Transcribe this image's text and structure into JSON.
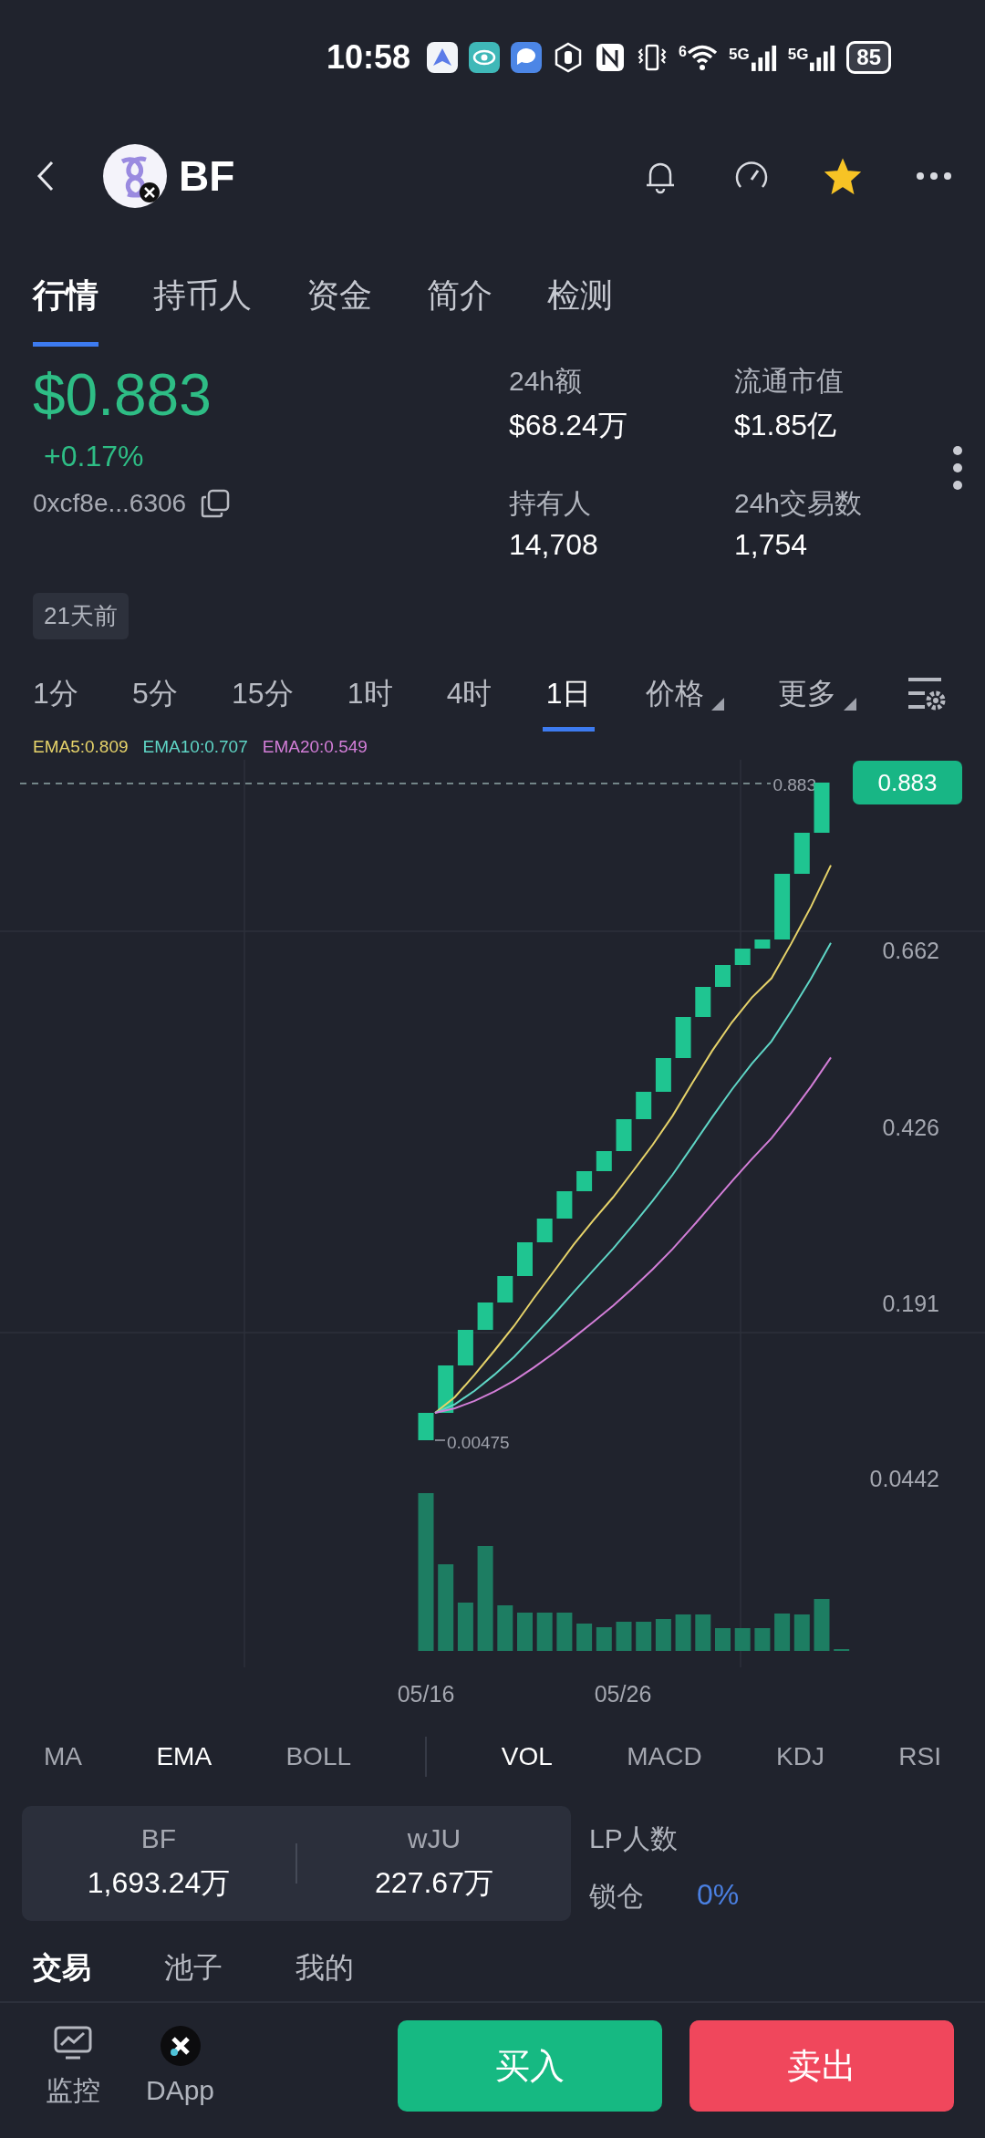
{
  "status_bar": {
    "time": "10:58",
    "wifi_label": "6",
    "network_labels": [
      "5G",
      "5G"
    ],
    "battery": "85"
  },
  "header": {
    "symbol": "BF",
    "favorite": true
  },
  "tabs": [
    {
      "label": "行情",
      "selected": true
    },
    {
      "label": "持币人",
      "selected": false
    },
    {
      "label": "资金",
      "selected": false
    },
    {
      "label": "简介",
      "selected": false
    },
    {
      "label": "检测",
      "selected": false
    }
  ],
  "price": {
    "value": "$0.883",
    "change": "+0.17%",
    "address": "0xcf8e...6306"
  },
  "stats": [
    {
      "label": "24h额",
      "value": "$68.24万"
    },
    {
      "label": "流通市值",
      "value": "$1.85亿"
    },
    {
      "label": "持有人",
      "value": "14,708"
    },
    {
      "label": "24h交易数",
      "value": "1,754"
    }
  ],
  "age_badge": "21天前",
  "intervals": [
    {
      "label": "1分",
      "kind": "interval",
      "selected": false
    },
    {
      "label": "5分",
      "kind": "interval",
      "selected": false
    },
    {
      "label": "15分",
      "kind": "interval",
      "selected": false
    },
    {
      "label": "1时",
      "kind": "interval",
      "selected": false
    },
    {
      "label": "4时",
      "kind": "interval",
      "selected": false
    },
    {
      "label": "1日",
      "kind": "interval",
      "selected": true
    },
    {
      "label": "价格",
      "kind": "dropdown",
      "selected": false
    },
    {
      "label": "更多",
      "kind": "dropdown",
      "selected": false
    }
  ],
  "ema_legend": [
    {
      "label": "EMA5:0.809",
      "color": "#e6d36a"
    },
    {
      "label": "EMA10:0.707",
      "color": "#5fd6c6"
    },
    {
      "label": "EMA20:0.549",
      "color": "#d37ed8"
    }
  ],
  "chart": {
    "price_tag": "0.883",
    "high_label": "0.883",
    "low_label": "0.00475",
    "y_labels": [
      "0.662",
      "0.426",
      "0.191",
      "0.0442"
    ],
    "x_labels": [
      "05/16",
      "05/26"
    ]
  },
  "main_indicators": [
    {
      "label": "MA",
      "selected": false
    },
    {
      "label": "EMA",
      "selected": true
    },
    {
      "label": "BOLL",
      "selected": false
    }
  ],
  "sub_indicators": [
    {
      "label": "VOL",
      "selected": true
    },
    {
      "label": "MACD",
      "selected": false
    },
    {
      "label": "KDJ",
      "selected": false
    },
    {
      "label": "RSI",
      "selected": false
    }
  ],
  "pool": {
    "tokens": [
      {
        "symbol": "BF",
        "amount": "1,693.24万"
      },
      {
        "symbol": "wJU",
        "amount": "227.67万"
      }
    ],
    "lp_label": "LP人数",
    "lock_label": "锁仓",
    "lock_value": "0%"
  },
  "bottom_tabs": [
    {
      "label": "交易",
      "selected": true
    },
    {
      "label": "池子",
      "selected": false
    },
    {
      "label": "我的",
      "selected": false
    }
  ],
  "nav": [
    {
      "label": "监控",
      "kind": "monitor"
    },
    {
      "label": "DApp",
      "kind": "dapp"
    }
  ],
  "actions": [
    {
      "label": "买入",
      "kind": "buy"
    },
    {
      "label": "卖出",
      "kind": "sell"
    }
  ]
}
